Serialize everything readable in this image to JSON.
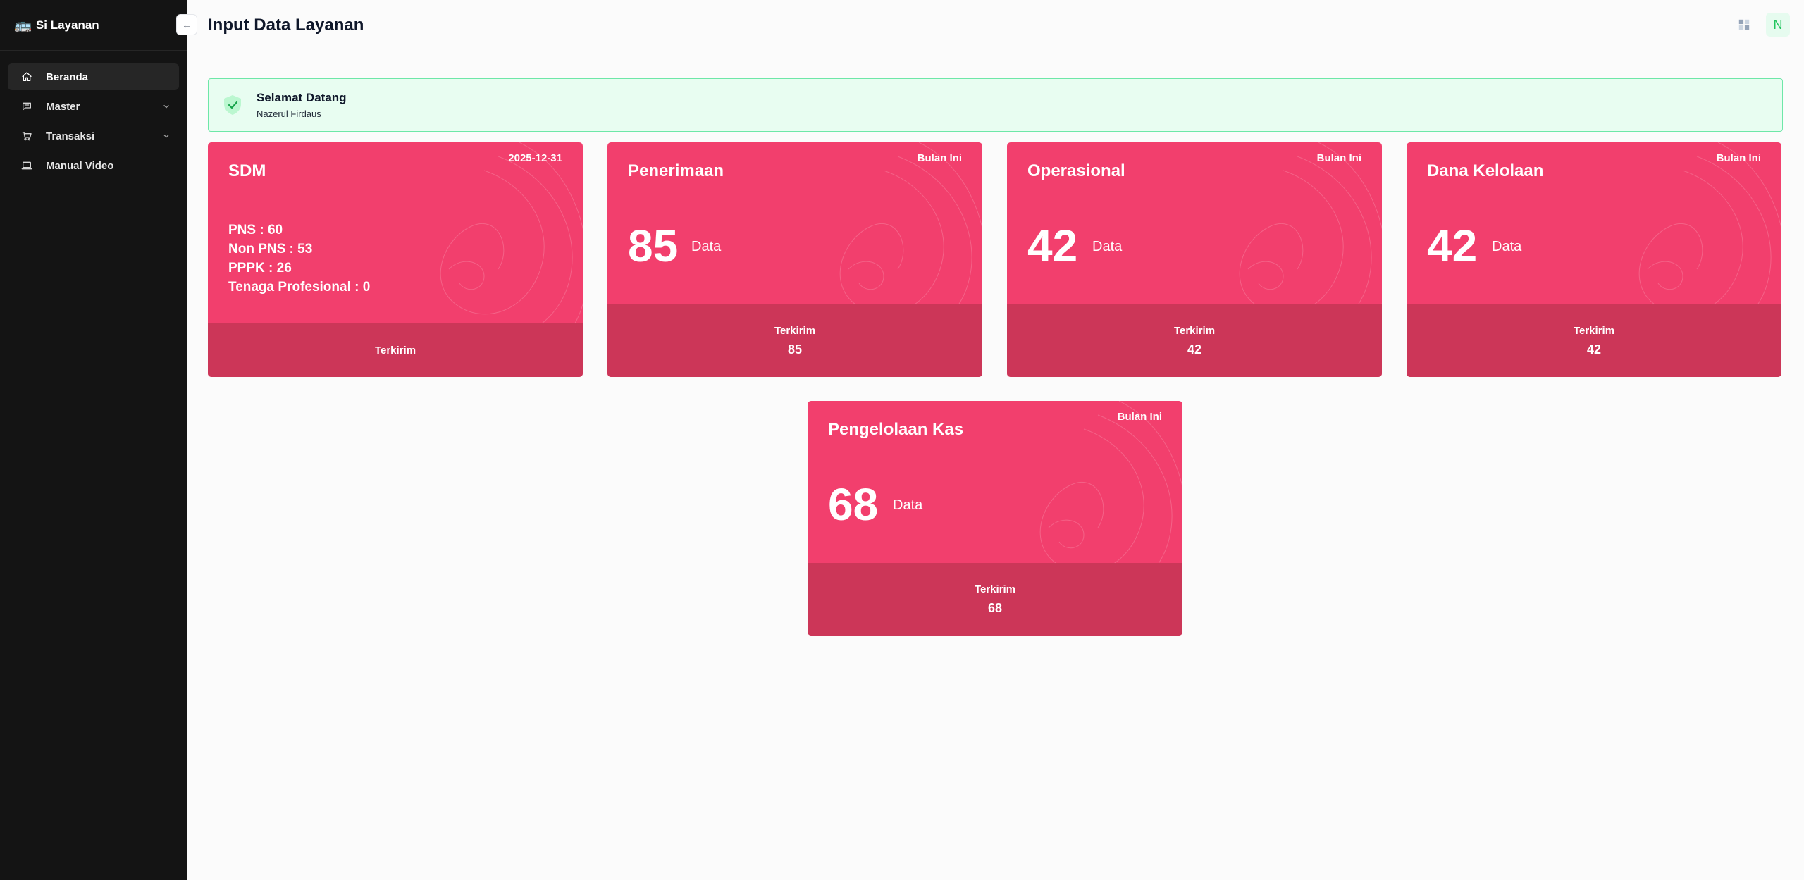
{
  "brand": {
    "icon": "bus-icon",
    "name": "Si Layanan"
  },
  "sidebar": {
    "items": [
      {
        "label": "Beranda",
        "icon": "home-icon",
        "active": true
      },
      {
        "label": "Master",
        "icon": "chat-icon",
        "has_children": true
      },
      {
        "label": "Transaksi",
        "icon": "cart-icon",
        "has_children": true
      },
      {
        "label": "Manual Video",
        "icon": "laptop-icon"
      }
    ]
  },
  "header": {
    "title": "Input Data Layanan",
    "avatar_initial": "N",
    "collapse_glyph": "←"
  },
  "welcome": {
    "title": "Selamat Datang",
    "user": "Nazerul Firdaus"
  },
  "cards": {
    "sdm": {
      "title": "SDM",
      "period": "2025-12-31",
      "lines": [
        "PNS : 60",
        "Non PNS : 53",
        "PPPK : 26",
        "Tenaga Profesional : 0"
      ],
      "footer_label": "Terkirim"
    },
    "penerimaan": {
      "title": "Penerimaan",
      "period": "Bulan Ini",
      "value": "85",
      "unit": "Data",
      "footer_label": "Terkirim",
      "footer_value": "85"
    },
    "operasional": {
      "title": "Operasional",
      "period": "Bulan Ini",
      "value": "42",
      "unit": "Data",
      "footer_label": "Terkirim",
      "footer_value": "42"
    },
    "dana": {
      "title": "Dana Kelolaan",
      "period": "Bulan Ini",
      "value": "42",
      "unit": "Data",
      "footer_label": "Terkirim",
      "footer_value": "42"
    },
    "kas": {
      "title": "Pengelolaan Kas",
      "period": "Bulan Ini",
      "value": "68",
      "unit": "Data",
      "footer_label": "Terkirim",
      "footer_value": "68"
    }
  },
  "colors": {
    "sidebar_bg": "#141414",
    "card_bg": "#f23f6d",
    "card_footer_bg": "#cc3658",
    "welcome_bg": "#e8fdf1",
    "welcome_border": "#6ee7a8",
    "success": "#22c55e"
  }
}
